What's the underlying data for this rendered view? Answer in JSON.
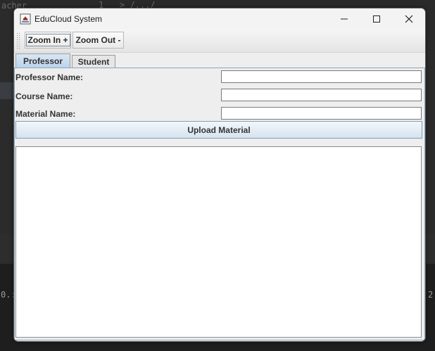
{
  "window": {
    "title": "EduCloud System",
    "icon": "java-cup-icon"
  },
  "toolbar": {
    "zoom_in_label": "Zoom In +",
    "zoom_out_label": "Zoom Out -"
  },
  "tabs": [
    {
      "label": "Professor",
      "selected": true
    },
    {
      "label": "Student",
      "selected": false
    }
  ],
  "form": {
    "professor_name_label": "Professor Name:",
    "professor_name_value": "",
    "course_name_label": "Course Name:",
    "course_name_value": "",
    "material_name_label": "Material Name:",
    "material_name_value": ""
  },
  "upload_button_label": "Upload Material",
  "output_text": "",
  "background": {
    "top_left_text": "acher",
    "line_number": "1",
    "path_text": "> /.../",
    "left_bottom_text": "0.:",
    "right_bottom_text": "2"
  },
  "colors": {
    "selected_tab": "#bcd3ea",
    "panel_border": "#8aa6c1",
    "window_bg": "#eeeeee"
  }
}
